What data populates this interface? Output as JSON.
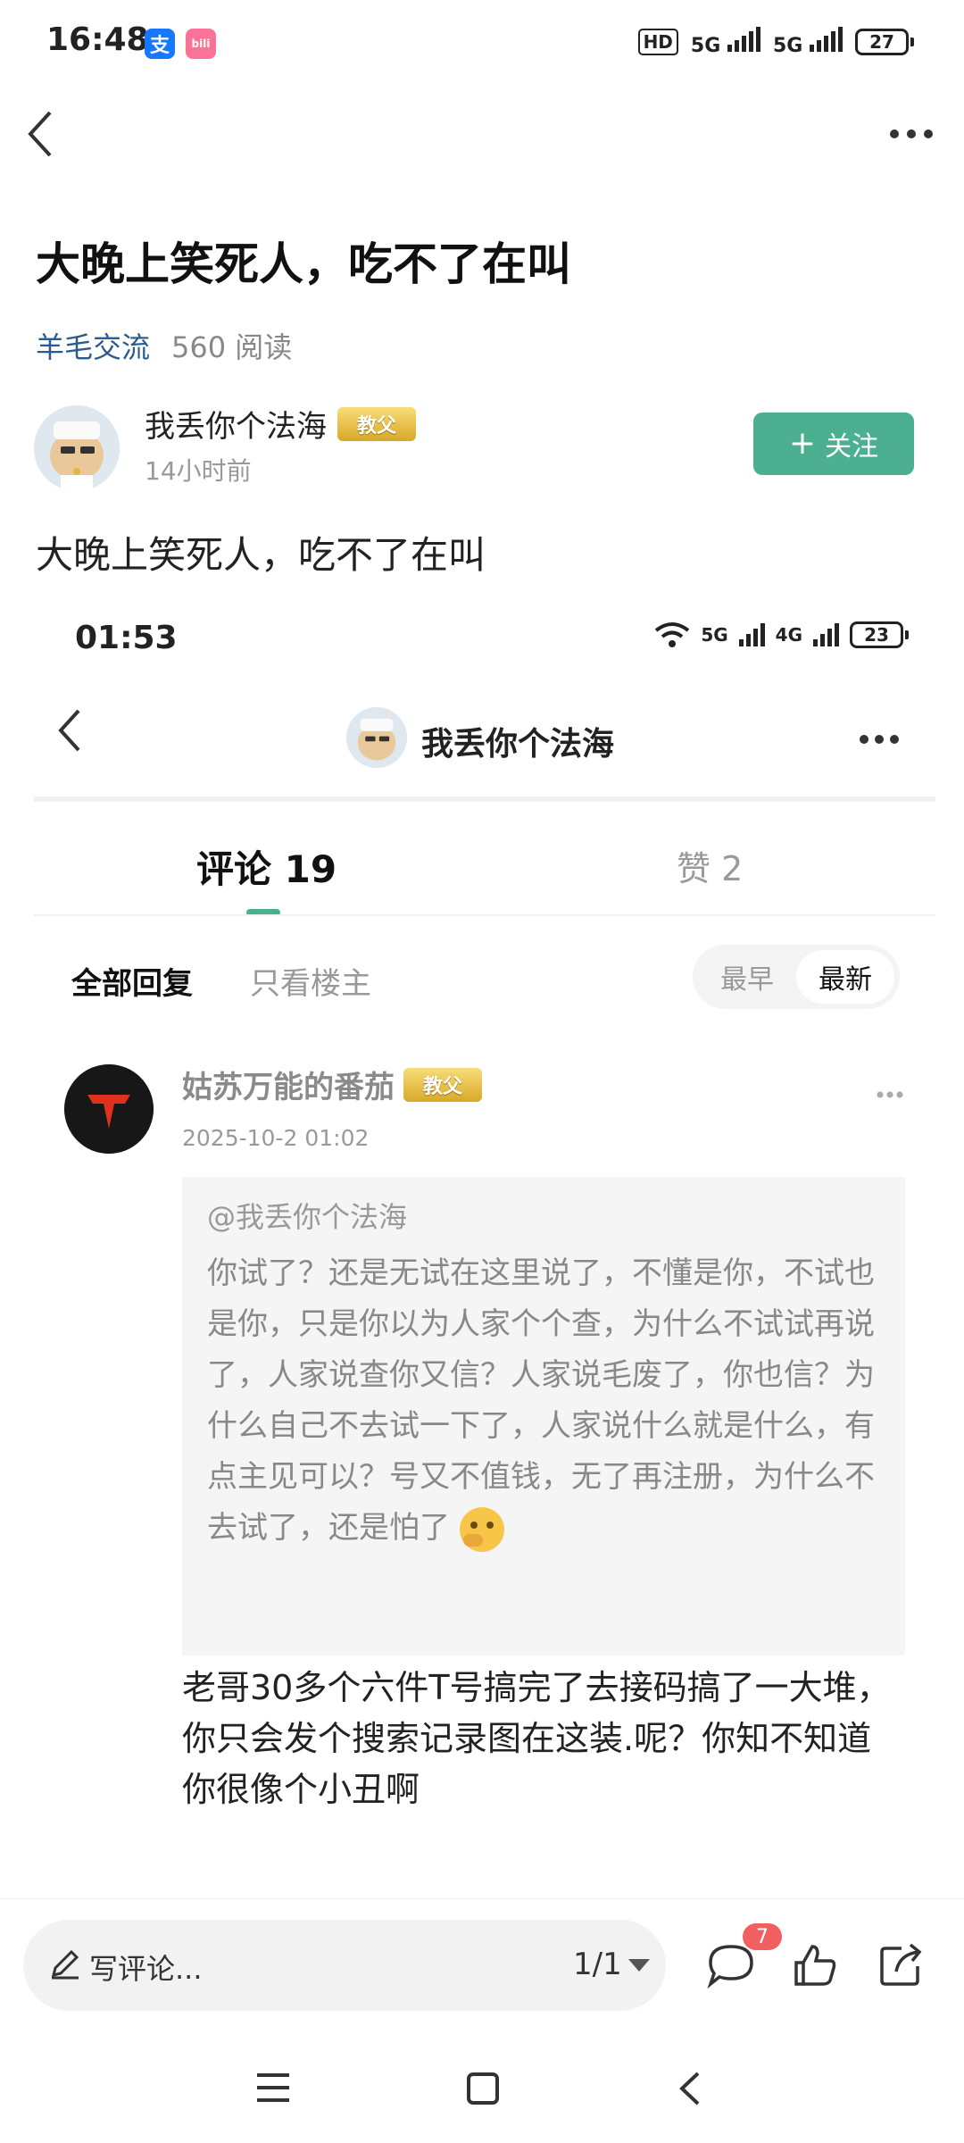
{
  "status_bar": {
    "time": "16:48",
    "app_icons": [
      {
        "name": "alipay-icon",
        "label": "支",
        "color": "#1677ff"
      },
      {
        "name": "bilibili-icon",
        "label": "bili",
        "color": "#fb7299"
      }
    ],
    "hd": "HD",
    "net1": "5G",
    "net2": "5G",
    "battery": "27"
  },
  "nav": {
    "back_icon": "chevron-left-icon",
    "more_icon": "more-icon"
  },
  "post": {
    "title": "大晚上笑死人，吃不了在叫",
    "category": "羊毛交流",
    "reads": "560 阅读",
    "author": "我丢你个法海",
    "author_badge": "教父",
    "time": "14小时前",
    "follow_label": "关注",
    "body": "大晚上笑死人，吃不了在叫"
  },
  "embedded": {
    "status_time": "01:53",
    "net1": "5G",
    "net2": "4G",
    "battery": "23",
    "header_name": "我丢你个法海",
    "tabs": [
      {
        "label": "评论 19",
        "active": true
      },
      {
        "label": "赞 2",
        "active": false
      }
    ],
    "filters": [
      "全部回复",
      "只看楼主"
    ],
    "sort": [
      "最早",
      "最新"
    ],
    "comment": {
      "name": "姑苏万能的番茄",
      "badge": "教父",
      "date": "2025-10-2 01:02",
      "quote_at": "@我丢你个法海",
      "quote_text": "你试了？还是无试在这里说了，不懂是你，不试也是你，只是你以为人家个个查，为什么不试试再说了，人家说查你又信？人家说毛废了，你也信？为什么自己不去试一下了，人家说什么就是什么，有点主见可以？号又不值钱，无了再注册，为什么不去试了，还是怕了",
      "reply": "老哥30多个六件T号搞完了去接码搞了一大堆，你只会发个搜索记录图在这装.呢？你知不知道你很像个小丑啊"
    }
  },
  "bottom": {
    "input_placeholder": "写评论...",
    "page": "1/1",
    "comment_count": "7"
  }
}
